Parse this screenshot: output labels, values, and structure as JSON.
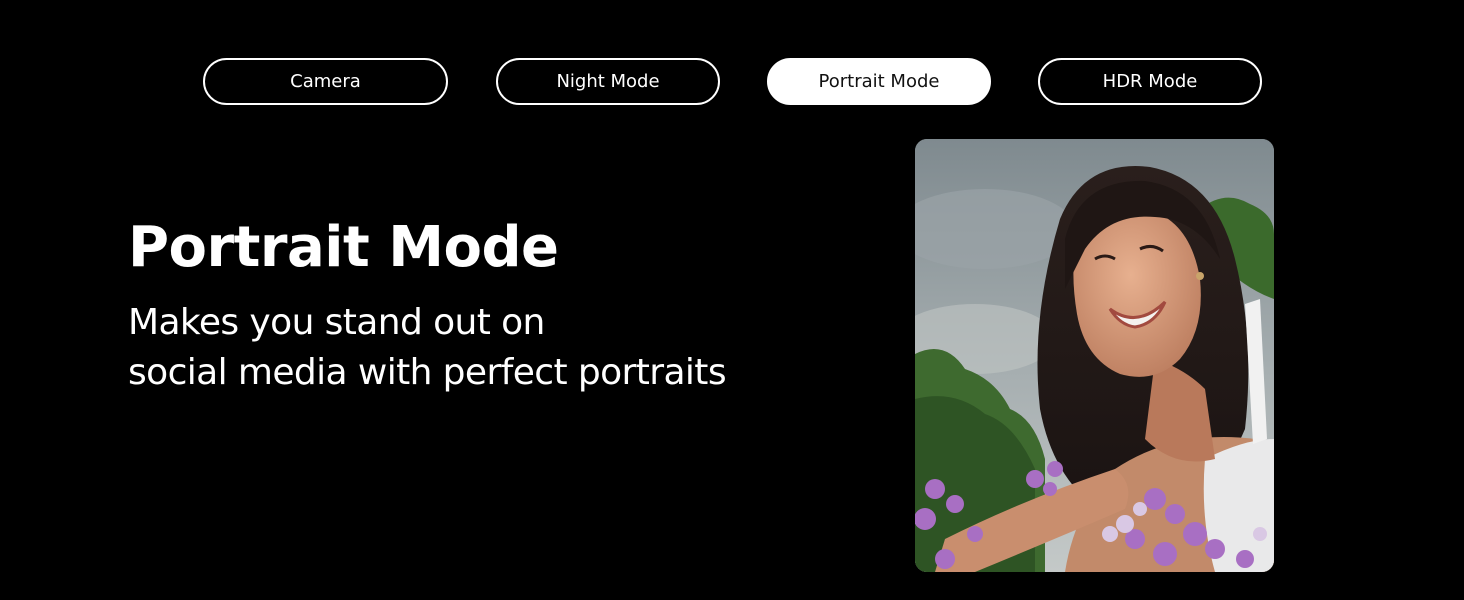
{
  "tabs": [
    {
      "label": "Camera",
      "active": false
    },
    {
      "label": "Night Mode",
      "active": false
    },
    {
      "label": "Portrait Mode",
      "active": true
    },
    {
      "label": "HDR Mode",
      "active": false
    }
  ],
  "hero": {
    "title": "Portrait Mode",
    "subtitle_line1": "Makes you stand out on",
    "subtitle_line2": "social media with perfect portraits"
  },
  "photo": {
    "subject": "smiling woman portrait outdoors with purple flowers and trees"
  },
  "colors": {
    "background": "#000000",
    "text": "#ffffff",
    "active_tab_bg": "#ffffff",
    "active_tab_text": "#111111"
  }
}
